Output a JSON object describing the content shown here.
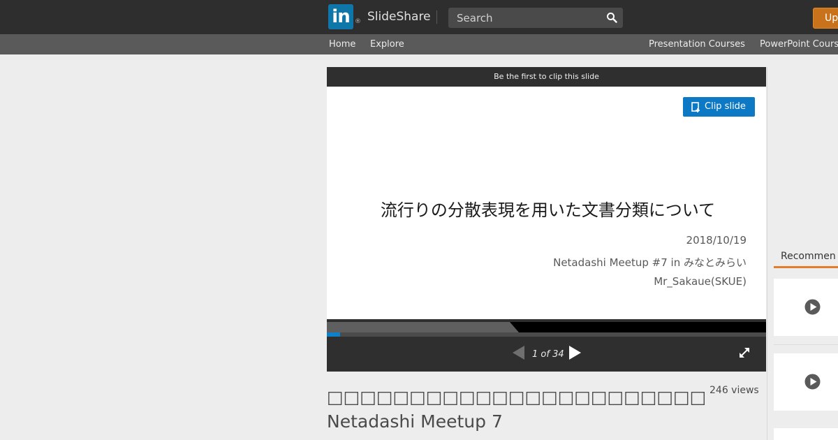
{
  "header": {
    "logo_text": "in",
    "registered_mark": "®",
    "brand": "SlideShare",
    "search_placeholder": "Search",
    "upload_label": "Up",
    "search_icon": "search-icon"
  },
  "subnav": {
    "home": "Home",
    "explore": "Explore",
    "presentation_courses": "Presentation Courses",
    "powerpoint_courses": "PowerPoint Cours"
  },
  "player": {
    "clip_banner": "Be the first to clip this slide",
    "clip_button": "Clip slide",
    "slide": {
      "title": "流行りの分散表現を用いた文書分類について",
      "date": "2018/10/19",
      "event": "Netadashi Meetup #7 in みなとみらい",
      "author": "Mr_Sakaue(SKUE)"
    },
    "page_indicator": "1 of 34",
    "current_page": 1,
    "total_pages": 34,
    "progress_fraction": 0.03,
    "icons": {
      "prev": "triangle-left-icon",
      "next": "triangle-right-icon",
      "fullscreen": "expand-arrows-icon",
      "clip": "clip-icon"
    }
  },
  "document": {
    "title": "□□□□□□□□□□□□□□□□□□□□□□□ Netadashi Meetup 7",
    "views": "246 views"
  },
  "sidebar": {
    "recommended_label": "Recommen",
    "cards": [
      {
        "icon": "play-icon"
      },
      {
        "icon": "play-icon"
      }
    ]
  },
  "colors": {
    "topbar": "#2e2e2e",
    "logo": "#0e76a8",
    "upload": "#c8731c",
    "clip_button": "#0d78c3",
    "progress": "#0f81c9",
    "recommended_underline": "#e37d2b"
  }
}
